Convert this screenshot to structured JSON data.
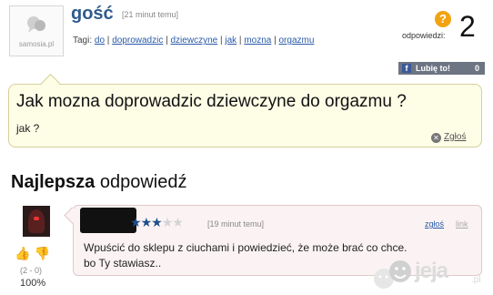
{
  "question": {
    "author": "gość",
    "time": "[21 minut temu]",
    "tags_label": "Tagi:",
    "tags": [
      "do",
      "doprowadzic",
      "dziewczyne",
      "jak",
      "mozna",
      "orgazmu"
    ],
    "title": "Jak mozna doprowadzic dziewczyne do orgazmu ?",
    "body": "jak ?",
    "report_label": "Zgłoś",
    "answers_label": "odpowiedzi:",
    "answers_count": "2",
    "avatar_brand": "samosia.pl",
    "question_icon": "?"
  },
  "like_button": {
    "label": "Lubię to!",
    "count": "0",
    "icon": "f"
  },
  "best_answer": {
    "heading_bold": "Najlepsza",
    "heading_rest": " odpowiedź",
    "rating": 3,
    "rating_max": 5,
    "time": "[19 minut temu]",
    "report_label": "zgłoś",
    "link_label": "link",
    "text_line1": "Wpuścić do sklepu z ciuchami i powiedzieć, że może brać co chce.",
    "text_line2": "bo Ty stawiasz..",
    "votes": "(2 - 0)",
    "percent": "100%"
  },
  "watermark": {
    "text": "jeja",
    "tld": ".pl"
  },
  "colors": {
    "accent": "#2f5b8d",
    "question_bg": "#fefde6",
    "answer_bg": "#fbf3f3",
    "star": "#1e4f8a"
  }
}
